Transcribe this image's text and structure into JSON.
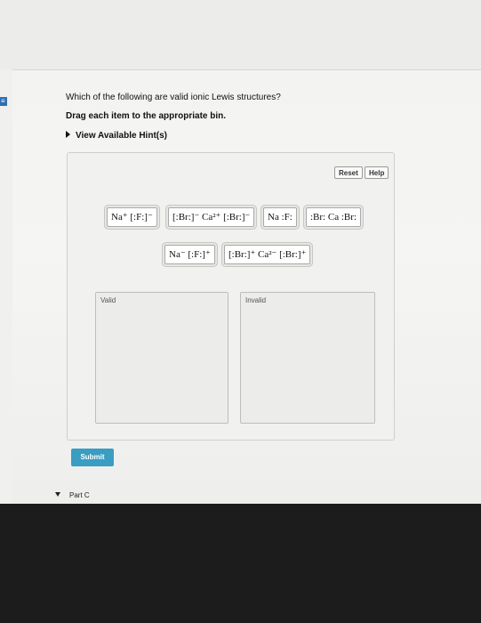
{
  "question": {
    "text": "Which of the following are valid ionic Lewis structures?",
    "instruction": "Drag each item to the appropriate bin.",
    "hints_label": "View Available Hint(s)"
  },
  "toolbar": {
    "reset_label": "Reset",
    "help_label": "Help"
  },
  "tiles": [
    {
      "text": "Na⁺ [:F:]⁻"
    },
    {
      "text": "[:Br:]⁻ Ca²⁺ [:Br:]⁻"
    },
    {
      "text": "Na :F:"
    },
    {
      "text": ":Br: Ca :Br:"
    },
    {
      "text": "Na⁻ [:F:]⁺"
    },
    {
      "text": "[:Br:]⁺ Ca²⁻ [:Br:]⁺"
    }
  ],
  "bins": {
    "valid_label": "Valid",
    "invalid_label": "Invalid"
  },
  "submit_label": "Submit",
  "next_part_label": "Part C",
  "colors": {
    "submit": "#3a9dc2",
    "tab_accent": "#2f6fb0"
  }
}
